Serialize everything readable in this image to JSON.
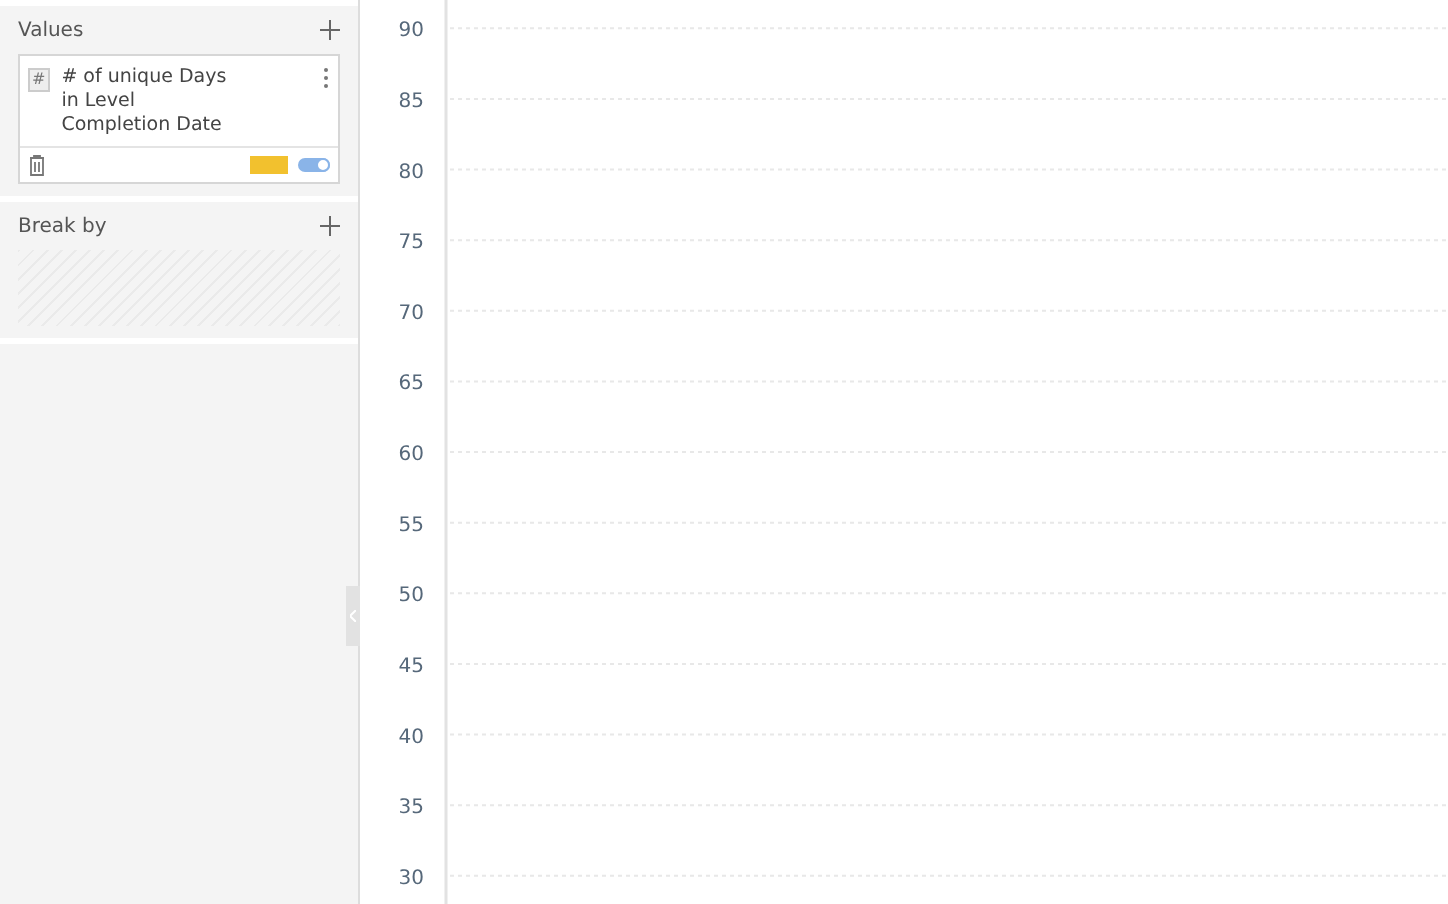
{
  "panel": {
    "values": {
      "title": "Values",
      "field": {
        "type_label": "#",
        "name": "# of unique Days in Level Completion Date",
        "color": "#f2c12e",
        "toggle_on": true
      }
    },
    "break_by": {
      "title": "Break by"
    }
  },
  "chart": {
    "chart_data": {
      "type": "bar",
      "categories": [
        null
      ],
      "values": [
        null
      ],
      "ylim": [
        28,
        92
      ],
      "grid": true,
      "yticks": [
        90,
        85,
        80,
        75,
        70,
        65,
        60,
        55,
        50,
        45,
        40,
        35,
        30
      ]
    }
  }
}
